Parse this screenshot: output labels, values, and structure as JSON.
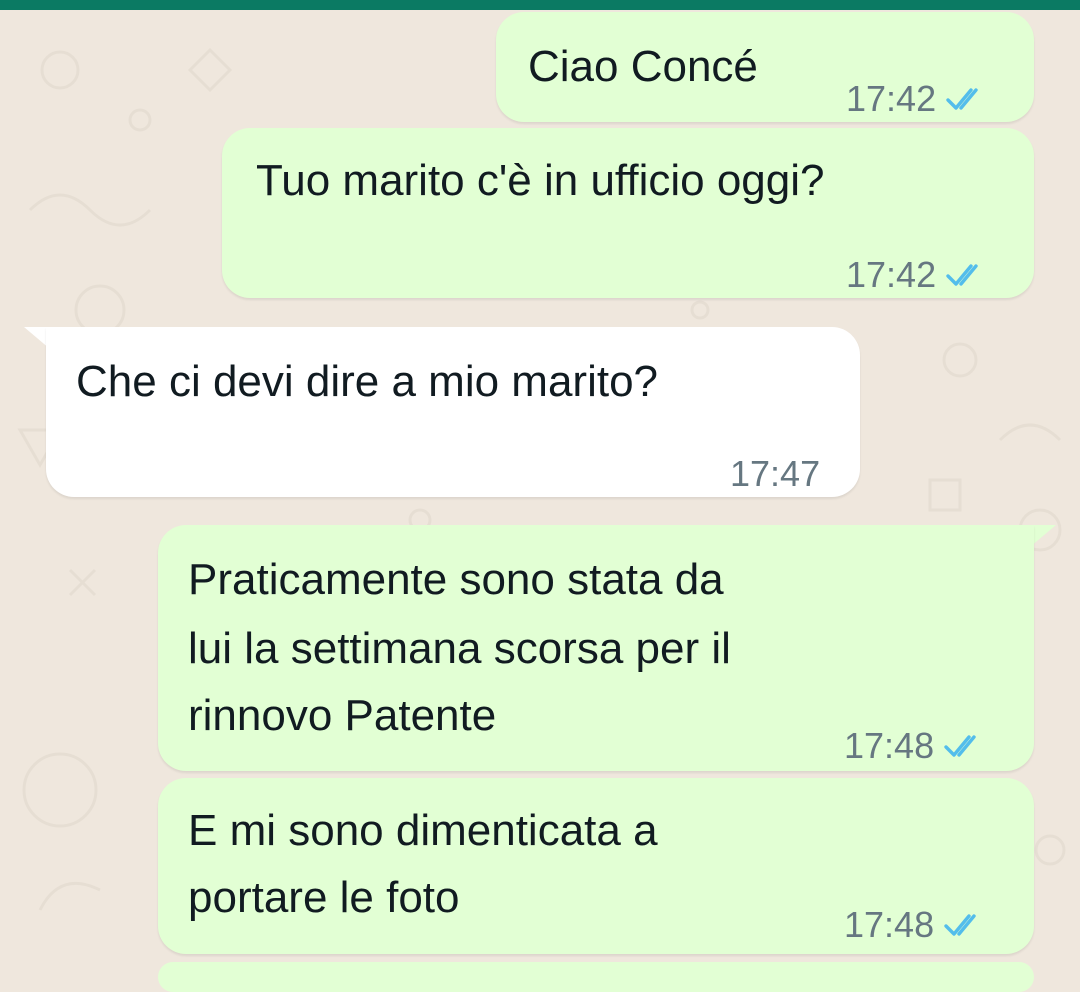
{
  "chat": {
    "messages": [
      {
        "direction": "outgoing",
        "text": "Ciao Concé",
        "time": "17:42",
        "status": "read"
      },
      {
        "direction": "outgoing",
        "text": "Tuo marito c'è in ufficio oggi?",
        "time": "17:42",
        "status": "read"
      },
      {
        "direction": "incoming",
        "text": "Che ci devi dire a mio marito?",
        "time": "17:47"
      },
      {
        "direction": "outgoing",
        "lines": [
          "Praticamente sono stata da",
          "lui la settimana scorsa per il",
          "rinnovo Patente"
        ],
        "time": "17:48",
        "status": "read"
      },
      {
        "direction": "outgoing",
        "lines": [
          "E mi sono dimenticata a",
          "portare le foto"
        ],
        "time": "17:48",
        "status": "read"
      }
    ]
  },
  "theme": {
    "header_color": "#0b7a63",
    "wallpaper_color": "#efe7dd",
    "outgoing_bubble": "#e2ffd4",
    "incoming_bubble": "#ffffff",
    "read_tick_color": "#53bdeb",
    "timestamp_color": "#667781",
    "icons": [
      "double-check-icon"
    ]
  }
}
